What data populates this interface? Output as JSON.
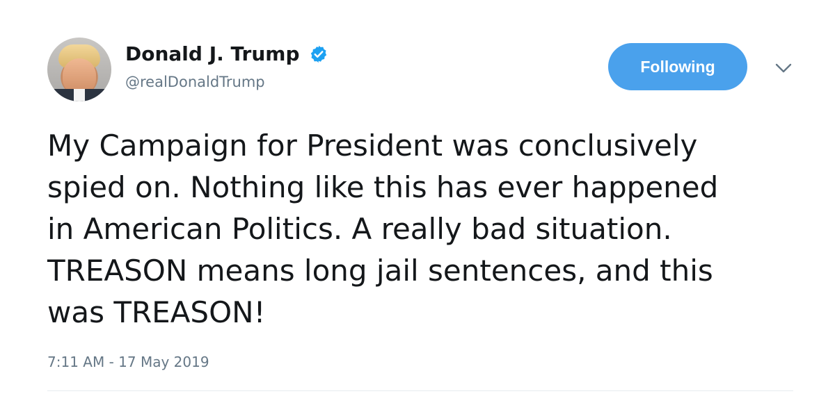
{
  "author": {
    "display_name": "Donald J. Trump",
    "handle": "@realDonaldTrump",
    "verified": true
  },
  "follow_button": {
    "label": "Following",
    "color": "#4aa1ec"
  },
  "tweet": {
    "text": "My Campaign for President was conclusively\nspied on. Nothing like this has ever happened\nin American Politics. A really bad situation.\nTREASON means long jail sentences, and this\nwas TREASON!",
    "timestamp": "7:11 AM - 17 May 2019"
  },
  "icons": {
    "verified": "verified-badge-icon",
    "caret": "chevron-down-icon"
  },
  "colors": {
    "text": "#14171a",
    "secondary": "#657786",
    "accent": "#1da1f2"
  }
}
